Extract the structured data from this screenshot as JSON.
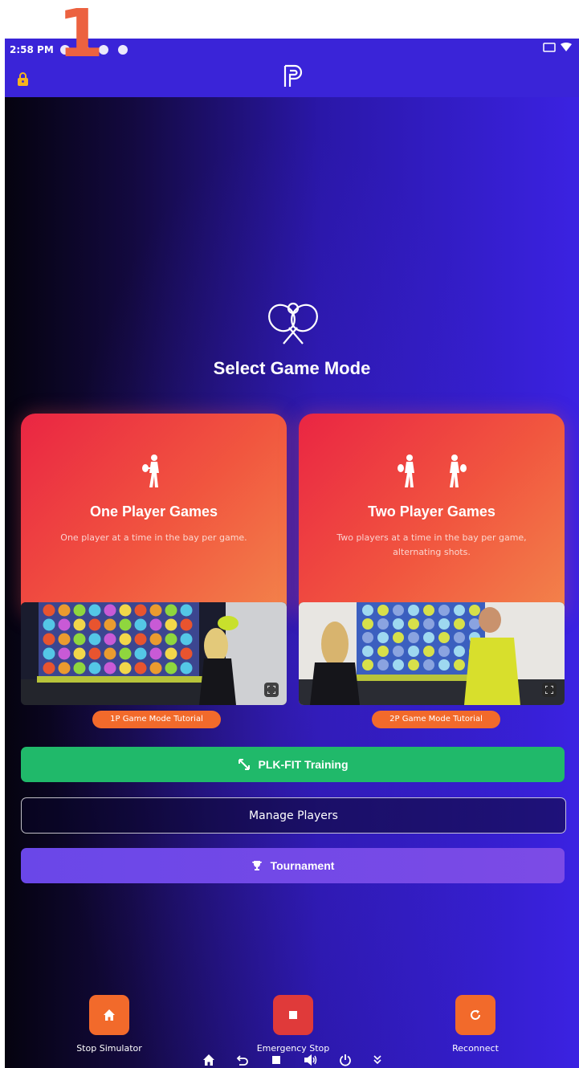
{
  "annotation": {
    "step_number": "1"
  },
  "status_bar": {
    "time": "2:58 PM"
  },
  "header": {
    "lock_icon": "lock-icon",
    "logo_icon": "brand-logo-icon"
  },
  "main": {
    "title": "Select Game Mode",
    "cards": [
      {
        "title": "One Player Games",
        "description": "One player at a time in the bay per game.",
        "tutorial_label": "1P Game Mode Tutorial"
      },
      {
        "title": "Two Player Games",
        "description": "Two players at a time in the bay per game, alternating shots.",
        "tutorial_label": "2P Game Mode Tutorial"
      }
    ],
    "buttons": {
      "plk_fit": "PLK-FIT Training",
      "manage_players": "Manage Players",
      "tournament": "Tournament"
    }
  },
  "bottom_bar": {
    "items": [
      {
        "label": "Stop Simulator",
        "icon": "home-icon"
      },
      {
        "label": "Emergency Stop",
        "icon": "stop-icon"
      },
      {
        "label": "Reconnect",
        "icon": "refresh-icon"
      }
    ]
  },
  "colors": {
    "header": "#3a24d8",
    "card_gradient_start": "#ea2543",
    "card_gradient_end": "#f3844b",
    "plk_green": "#20b96a",
    "tournament_purple": "#7c4be6",
    "accent_orange": "#f26a2b",
    "stop_red": "#e03a3a"
  }
}
